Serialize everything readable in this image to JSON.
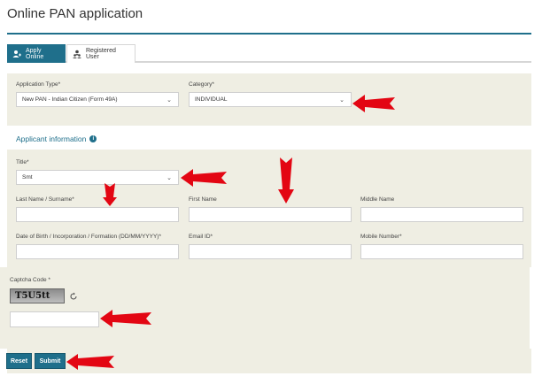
{
  "page": {
    "title": "Online PAN application"
  },
  "tabs": [
    {
      "label": "Apply Online",
      "icon": "user-icon",
      "active": true
    },
    {
      "label": "Registered User",
      "icon": "users-icon",
      "active": false
    }
  ],
  "application_type": {
    "label": "Application Type*",
    "value": "New PAN - Indian Citizen (Form 49A)"
  },
  "category": {
    "label": "Category*",
    "value": "INDIVIDUAL"
  },
  "applicant_info": {
    "heading": "Applicant information",
    "icon": "info-icon"
  },
  "title_field": {
    "label": "Title*",
    "value": "Smt"
  },
  "last_name": {
    "label": "Last Name / Surname*",
    "value": ""
  },
  "first_name": {
    "label": "First Name",
    "value": ""
  },
  "middle_name": {
    "label": "Middle Name",
    "value": ""
  },
  "dob": {
    "label": "Date of Birth / Incorporation / Formation (DD/MM/YYYY)*",
    "value": ""
  },
  "email": {
    "label": "Email ID*",
    "value": ""
  },
  "mobile": {
    "label": "Mobile Number*",
    "value": ""
  },
  "captcha": {
    "label": "Captcha Code *",
    "image_text": "T5U5tt",
    "value": ""
  },
  "buttons": {
    "reset": "Reset",
    "submit": "Submit"
  },
  "colors": {
    "accent": "#1f6f8b",
    "panel": "#efeee3",
    "arrow": "#e30613"
  }
}
